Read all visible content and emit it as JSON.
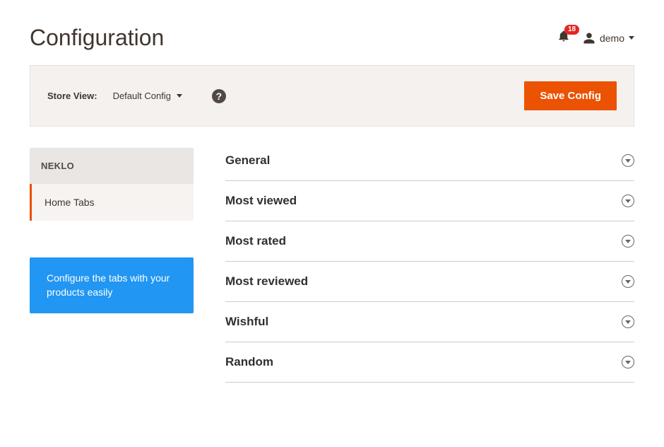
{
  "page": {
    "title": "Configuration"
  },
  "header": {
    "notification_count": "18",
    "username": "demo"
  },
  "toolbar": {
    "store_view_label": "Store View:",
    "store_view_value": "Default Config",
    "save_label": "Save Config"
  },
  "sidebar": {
    "section_title": "NEKLO",
    "items": [
      {
        "label": "Home Tabs"
      }
    ],
    "info_text": "Configure the tabs with your products easily"
  },
  "sections": [
    {
      "label": "General"
    },
    {
      "label": "Most viewed"
    },
    {
      "label": "Most rated"
    },
    {
      "label": "Most reviewed"
    },
    {
      "label": "Wishful"
    },
    {
      "label": "Random"
    }
  ]
}
